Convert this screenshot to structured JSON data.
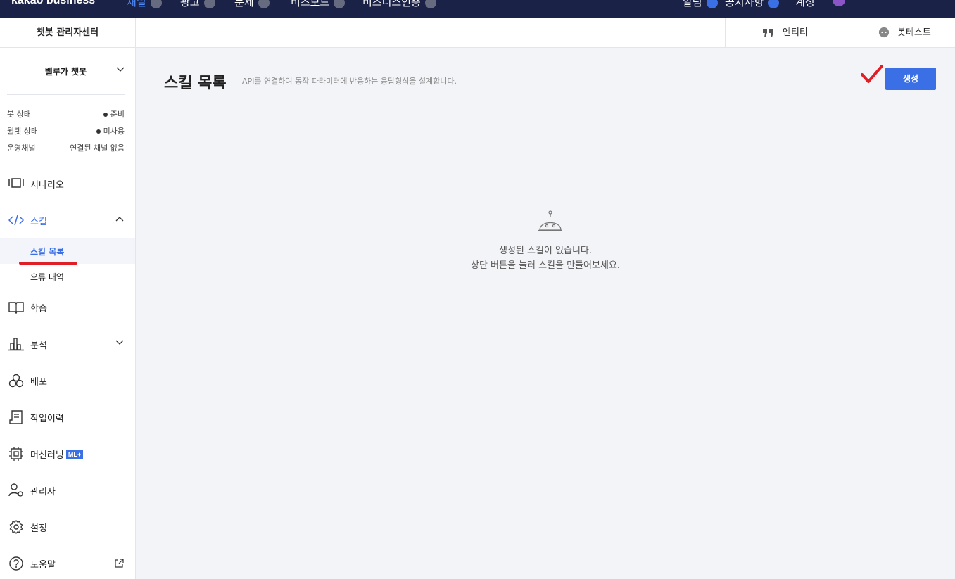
{
  "topbar": {
    "logo": "kakao business",
    "nav": [
      "채널",
      "광고",
      "문제",
      "비즈보드",
      "비즈니스인증"
    ],
    "right": [
      "알림",
      "공지사항",
      "계정"
    ]
  },
  "header": {
    "center_title": "챗봇 관리자센터",
    "entity_label": "엔티티",
    "bottest_label": "봇테스트"
  },
  "sidebar": {
    "bot_name": "벨루가 챗봇",
    "status": [
      {
        "label": "봇 상태",
        "value": "준비",
        "bullet": true
      },
      {
        "label": "윌렛 상태",
        "value": "미사용",
        "bullet": true
      },
      {
        "label": "운영채널",
        "value": "연결된 채널 없음",
        "bullet": false
      }
    ],
    "menu": {
      "scenario": "시나리오",
      "skill": "스킬",
      "skill_list": "스킬 목록",
      "error_log": "오류 내역",
      "learning": "학습",
      "analysis": "분석",
      "deploy": "배포",
      "history": "작업이력",
      "ml": "머신러닝",
      "ml_badge": "ML+",
      "admin": "관리자",
      "settings": "설정",
      "help": "도움말"
    }
  },
  "main": {
    "title": "스킬 목록",
    "description": "API를 연결하여 동작 파라미터에 반응하는 응답형식을 설계합니다.",
    "create_button": "생성",
    "empty_line1": "생성된 스킬이 없습니다.",
    "empty_line2": "상단 버튼을 눌러 스킬을 만들어보세요."
  },
  "colors": {
    "navy": "#1b2247",
    "accent": "#3b6fe6",
    "annotation_red": "#e01e26",
    "main_bg": "#f3f4f8"
  }
}
